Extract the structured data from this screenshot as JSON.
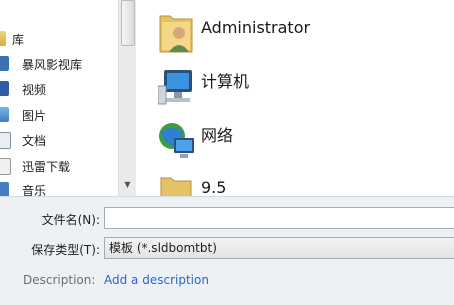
{
  "nav": {
    "items": [
      {
        "label": "库",
        "icon": "library-icon"
      },
      {
        "label": "暴风影视库",
        "icon": "video-library-icon"
      },
      {
        "label": "视频",
        "icon": "video-folder-icon"
      },
      {
        "label": "图片",
        "icon": "pictures-folder-icon"
      },
      {
        "label": "文档",
        "icon": "documents-folder-icon"
      },
      {
        "label": "迅雷下载",
        "icon": "download-folder-icon"
      },
      {
        "label": "音乐",
        "icon": "music-folder-icon"
      }
    ]
  },
  "content": {
    "items": [
      {
        "label": "Administrator",
        "icon": "user-folder-icon"
      },
      {
        "label": "计算机",
        "icon": "computer-icon"
      },
      {
        "label": "网络",
        "icon": "network-icon"
      },
      {
        "label": "9.5",
        "icon": "folder-icon"
      }
    ]
  },
  "form": {
    "filename_label": "文件名(N):",
    "filename_value": "",
    "filetype_label": "保存类型(T):",
    "filetype_value": "模板 (*.sldbomtbt)",
    "description_label": "Description:",
    "description_link": "Add a description"
  },
  "colors": {
    "bottom_panel": "#edf1f6",
    "link": "#2a66c5"
  }
}
